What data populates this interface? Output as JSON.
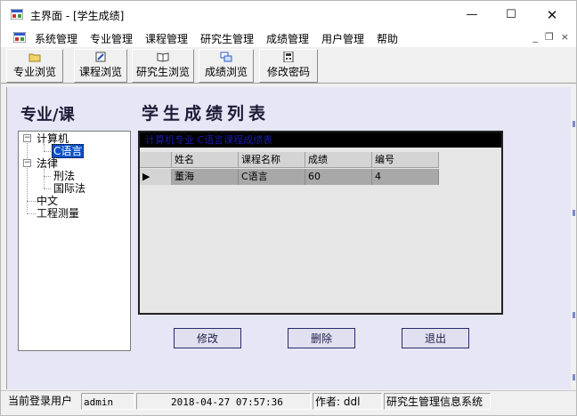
{
  "window": {
    "title": "主界面 - [学生成绩]",
    "min_glyph": "—",
    "max_glyph": "☐",
    "close_glyph": "✕"
  },
  "menubar": {
    "items": [
      "系统管理",
      "专业管理",
      "课程管理",
      "研究生管理",
      "成绩管理",
      "用户管理",
      "帮助"
    ],
    "mdi_min": "_",
    "mdi_restore": "❐",
    "mdi_close": "×"
  },
  "toolbar": {
    "buttons": [
      {
        "label": "专业浏览",
        "icon": "folder-icon"
      },
      {
        "label": "课程浏览",
        "icon": "edit-document-icon"
      },
      {
        "label": "研究生浏览",
        "icon": "open-book-icon"
      },
      {
        "label": "成绩浏览",
        "icon": "window-stack-icon"
      },
      {
        "label": "修改密码",
        "icon": "password-calculator-icon"
      }
    ]
  },
  "left_panel": {
    "title": "专业/课",
    "tree": [
      {
        "label": "计算机",
        "expanded": true,
        "children": [
          "C语言"
        ]
      },
      {
        "label": "法律",
        "expanded": true,
        "children": [
          "刑法",
          "国际法"
        ]
      },
      {
        "label": "中文",
        "children": []
      },
      {
        "label": "工程测量",
        "children": []
      }
    ],
    "selected": "C语言",
    "expand_glyph": "−"
  },
  "main": {
    "title": "学生成绩列表",
    "grid_caption": "计算机专业 C语言课程成绩表",
    "columns": [
      "姓名",
      "课程名称",
      "成绩",
      "编号"
    ],
    "rows": [
      [
        "董海",
        "C语言",
        "60",
        "4"
      ]
    ],
    "row_indicator": "▶",
    "buttons": {
      "edit": "修改",
      "delete": "删除",
      "exit": "退出"
    }
  },
  "statusbar": {
    "login_label": "当前登录用户",
    "user": "admin",
    "datetime": "2018-04-27 07:57:36",
    "author_label": "作者: ddl",
    "system_name": "研究生管理信息系统"
  },
  "colors": {
    "client_bg": "#e6e6f6",
    "title_text": "#1c1c38",
    "selection": "#0a52c8",
    "grid_caption_bg": "#000000",
    "grid_caption_text": "#1a1aa8",
    "row_bg": "#a8a8a8"
  }
}
